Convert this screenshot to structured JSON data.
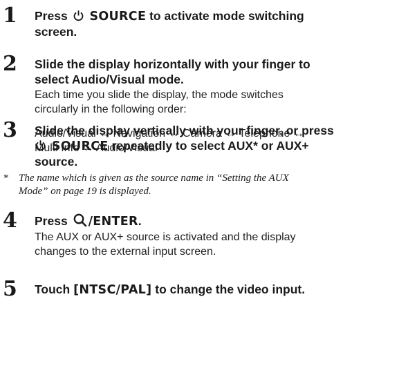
{
  "steps": [
    {
      "number": "1",
      "heading_pre": "Press",
      "heading_key": "SOURCE",
      "heading_post": "to activate mode switching",
      "heading_line2": "screen."
    },
    {
      "number": "2",
      "heading_line1": "Slide the display horizontally with your finger to",
      "heading_line2": "select Audio/Visual mode.",
      "desc_line1": "Each time you slide the display, the mode switches",
      "desc_line2": "circularly in the following order:",
      "order_line1": "Audio/Visual ↔ Navigation ↔ Camera ↔ Telephone ↔",
      "order_line2": "Multi Info ↔ Audio/Visual"
    },
    {
      "number": "3",
      "heading_line1": "Slide the display vertically with your finger, or press",
      "heading_key": "SOURCE",
      "heading_post": "repeatedly to select AUX* or AUX+",
      "heading_line3": "source."
    },
    {
      "number": "4",
      "heading_pre": "Press",
      "heading_key": "/ENTER",
      "heading_post": ".",
      "desc_line1": "The AUX or AUX+ source is activated and the display",
      "desc_line2": "changes to the external input screen."
    },
    {
      "number": "5",
      "heading_pre": "Touch",
      "heading_key": "[NTSC/PAL]",
      "heading_post": "to change the video input."
    }
  ],
  "footnote": {
    "marker": "*",
    "line1": "The name which is given as the source name in “Setting the AUX",
    "line2": "Mode” on page 19 is displayed."
  },
  "icons": {
    "power": "power-icon",
    "search": "magnifier-icon"
  }
}
